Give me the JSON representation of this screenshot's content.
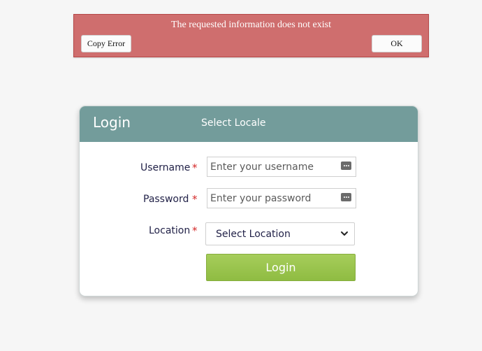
{
  "error_dialog": {
    "message": "The requested information does not exist",
    "copy_label": "Copy Error",
    "ok_label": "OK"
  },
  "login": {
    "title": "Login",
    "locale_label": "Select Locale",
    "username": {
      "label": "Username",
      "placeholder": "Enter your username",
      "required_mark": "*"
    },
    "password": {
      "label": "Password",
      "placeholder": "Enter your password",
      "required_mark": "*"
    },
    "location": {
      "label": "Location",
      "selected": "Select Location",
      "required_mark": "*"
    },
    "submit_label": "Login"
  },
  "icons": {
    "field_autofill": "password-key-icon",
    "select_arrow": "chevron-down-icon"
  },
  "colors": {
    "error_bg": "#cf6e6e",
    "header_bg": "#739c9b",
    "button_green": "#9cc54d",
    "label_color": "#222248",
    "required_color": "#d42a2a"
  }
}
